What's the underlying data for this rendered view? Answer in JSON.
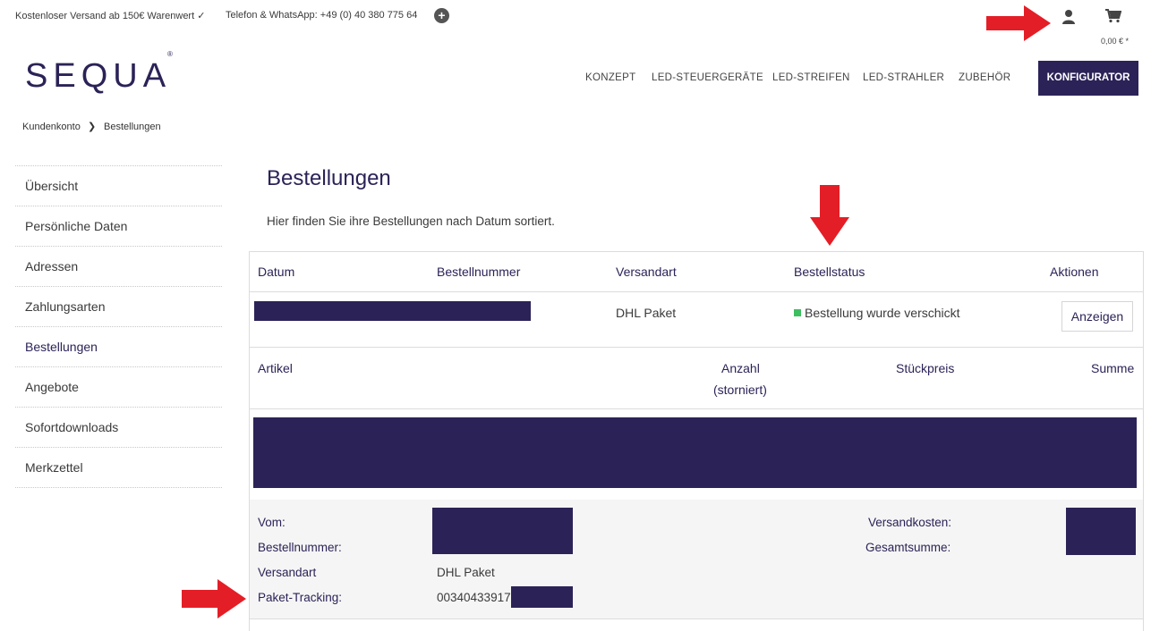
{
  "topbar": {
    "shipping_text": "Kostenloser Versand ab 150€ Warenwert ✓",
    "phone_text": "Telefon & WhatsApp: +49 (0) 40 380 775 64",
    "plus_glyph": "+",
    "cart_total": "0,00 € *"
  },
  "logo": {
    "text": "SEQUA",
    "mark": "®"
  },
  "nav": {
    "items": [
      "KONZEPT",
      "LED-STEUERGERÄTE",
      "LED-STREIFEN",
      "LED-STRAHLER",
      "ZUBEHÖR"
    ],
    "cta": "KONFIGURATOR"
  },
  "breadcrumb": {
    "items": [
      "Kundenkonto",
      "Bestellungen"
    ],
    "separator": "❯"
  },
  "sidebar": {
    "items": [
      {
        "label": "Übersicht"
      },
      {
        "label": "Persönliche Daten"
      },
      {
        "label": "Adressen"
      },
      {
        "label": "Zahlungsarten"
      },
      {
        "label": "Bestellungen",
        "active": true
      },
      {
        "label": "Angebote"
      },
      {
        "label": "Sofortdownloads"
      },
      {
        "label": "Merkzettel"
      }
    ]
  },
  "page": {
    "title": "Bestellungen",
    "intro": "Hier finden Sie ihre Bestellungen nach Datum sortiert."
  },
  "orders_table": {
    "headers": {
      "date": "Datum",
      "number": "Bestellnummer",
      "shipping": "Versandart",
      "status": "Bestellstatus",
      "actions": "Aktionen"
    },
    "row": {
      "shipping": "DHL Paket",
      "status": "Bestellung wurde verschickt",
      "status_color": "#3cbf60",
      "action_label": "Anzeigen"
    },
    "items_headers": {
      "article": "Artikel",
      "quantity": "Anzahl",
      "cancelled": "(storniert)",
      "unit_price": "Stückpreis",
      "total": "Summe"
    }
  },
  "summary": {
    "from_label": "Vom:",
    "number_label": "Bestellnummer:",
    "shipping_label": "Versandart",
    "shipping_value": "DHL Paket",
    "tracking_label": "Paket-Tracking:",
    "tracking_value": "00340433917",
    "shipping_cost_label": "Versandkosten:",
    "grand_total_label": "Gesamtsumme:"
  },
  "colors": {
    "brand": "#2b2357",
    "annotation_arrow": "#e41e26",
    "status_ok": "#3cbf60"
  }
}
